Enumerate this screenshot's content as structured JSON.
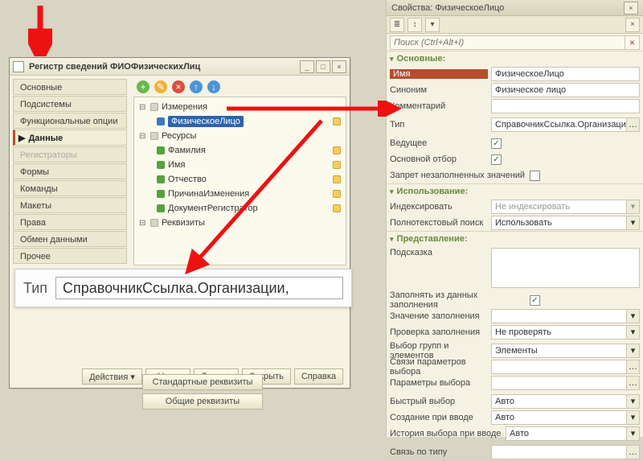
{
  "register": {
    "title": "Регистр сведений ФИОФизическихЛиц",
    "sidebar": [
      {
        "label": "Основные"
      },
      {
        "label": "Подсистемы"
      },
      {
        "label": "Функциональные опции"
      },
      {
        "label": "Данные",
        "active": true
      },
      {
        "label": "Регистраторы",
        "disabled": true
      },
      {
        "label": "Формы"
      },
      {
        "label": "Команды"
      },
      {
        "label": "Макеты"
      },
      {
        "label": "Права"
      },
      {
        "label": "Обмен данными"
      },
      {
        "label": "Прочее"
      }
    ],
    "tree": {
      "dimensions_label": "Измерения",
      "dimension_items": [
        {
          "label": "ФизическоеЛицо",
          "selected": true,
          "drag": true
        }
      ],
      "resources_label": "Ресурсы",
      "resource_items": [
        {
          "label": "Фамилия",
          "drag": true
        },
        {
          "label": "Имя",
          "drag": true
        },
        {
          "label": "Отчество",
          "drag": true
        },
        {
          "label": "ПричинаИзменения",
          "drag": true
        },
        {
          "label": "ДокументРегистратор",
          "drag": true
        }
      ],
      "attributes_label": "Реквизиты"
    },
    "extra_buttons": {
      "standard": "Стандартные реквизиты",
      "common": "Общие реквизиты"
    },
    "footer": {
      "actions": "Действия",
      "back": "<Назад",
      "next": "Далее>",
      "close": "Закрыть",
      "help": "Справка"
    }
  },
  "zoom": {
    "label": "Тип",
    "value": "СправочникСсылка.Организации,"
  },
  "props": {
    "title": "Свойства: ФизическоеЛицо",
    "search_placeholder": "Поиск (Ctrl+Alt+I)",
    "sections": {
      "main": "Основные:",
      "use": "Использование:",
      "present": "Представление:"
    },
    "rows": {
      "name_k": "Имя",
      "name_v": "ФизическоеЛицо",
      "syn_k": "Синоним",
      "syn_v": "Физическое лицо",
      "comm_k": "Комментарий",
      "comm_v": "",
      "type_k": "Тип",
      "type_v": "СправочникСсылка.Организации, СправочникСсылка.Физические",
      "lead_k": "Ведущее",
      "lead_chk": "✓",
      "main_k": "Основной отбор",
      "main_chk": "✓",
      "noempty_k": "Запрет незаполненных значений",
      "noempty_chk": "",
      "index_k": "Индексировать",
      "index_v": "Не индексировать",
      "fulltext_k": "Полнотекстовый поиск",
      "fulltext_v": "Использовать",
      "hint_k": "Подсказка",
      "filldata_k": "Заполнять из данных заполнения",
      "filldata_chk": "✓",
      "fillval_k": "Значение заполнения",
      "fillval_v": "",
      "check_k": "Проверка заполнения",
      "check_v": "Не проверять",
      "groupsel_k": "Выбор групп и элементов",
      "groupsel_v": "Элементы",
      "paramlink_k": "Связи параметров выбора",
      "paramlink_v": "",
      "param_k": "Параметры выбора",
      "param_v": "",
      "quick_k": "Быстрый выбор",
      "quick_v": "Авто",
      "create_k": "Создание при вводе",
      "create_v": "Авто",
      "history_k": "История выбора при вводе",
      "history_v": "Авто",
      "linktype_k": "Связь по типу",
      "linktype_v": ""
    }
  }
}
